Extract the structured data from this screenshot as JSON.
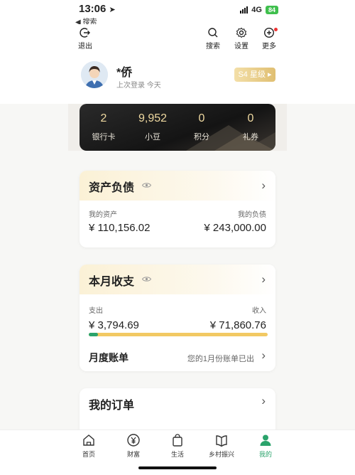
{
  "status": {
    "time": "13:06",
    "back": "◀ 搜索",
    "network": "4G",
    "battery": "84"
  },
  "topbar": {
    "logout": "退出",
    "search": "搜索",
    "settings": "设置",
    "more": "更多"
  },
  "profile": {
    "name": "*侨",
    "last_login": "上次登录 今天",
    "level": "S4 星级"
  },
  "stats": [
    {
      "num": "2",
      "label": "银行卡"
    },
    {
      "num": "9,952",
      "label": "小豆"
    },
    {
      "num": "0",
      "label": "积分"
    },
    {
      "num": "0",
      "label": "礼券"
    }
  ],
  "assets": {
    "title": "资产负债",
    "assets_label": "我的资产",
    "assets_value": "¥ 110,156.02",
    "debt_label": "我的负债",
    "debt_value": "¥ 243,000.00"
  },
  "monthly": {
    "title": "本月收支",
    "expense_label": "支出",
    "expense_value": "¥ 3,794.69",
    "income_label": "收入",
    "income_value": "¥ 71,860.76",
    "expense_fraction": 0.05,
    "bill_title": "月度账单",
    "bill_note": "您的1月份账单已出"
  },
  "orders": {
    "title": "我的订单"
  },
  "tabs": [
    {
      "label": "首页"
    },
    {
      "label": "财富"
    },
    {
      "label": "生活"
    },
    {
      "label": "乡村振兴"
    },
    {
      "label": "我的"
    }
  ],
  "colors": {
    "accent": "#2aa36b",
    "gold": "#e0bf72",
    "income_bar": "#f2c963"
  }
}
